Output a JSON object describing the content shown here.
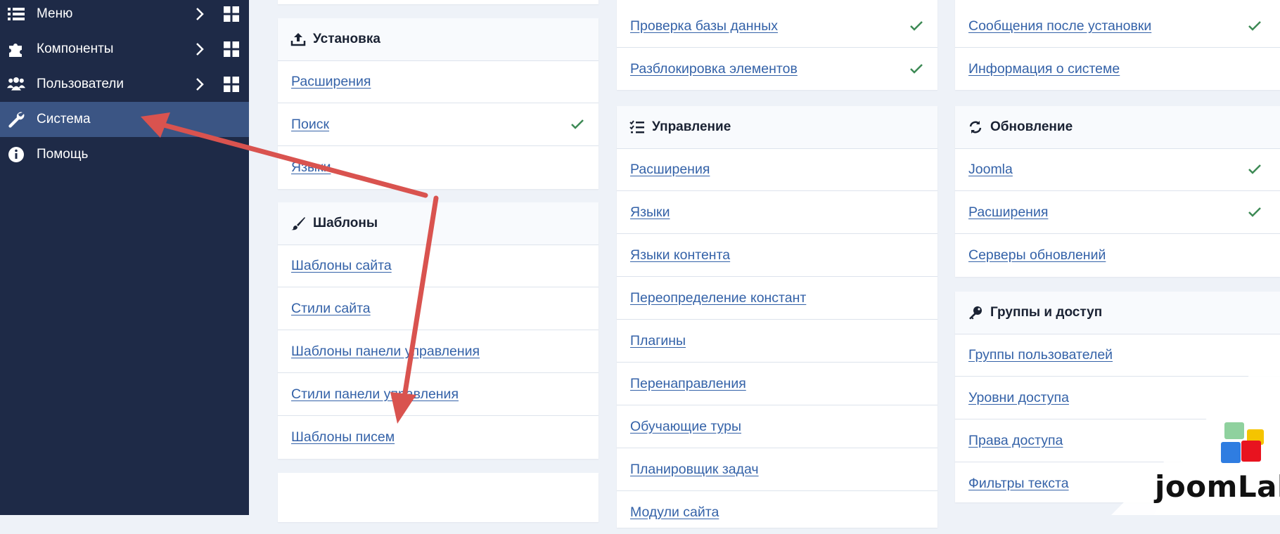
{
  "sidebar": {
    "items": [
      {
        "label": "Меню",
        "icon": "list-icon"
      },
      {
        "label": "Компоненты",
        "icon": "puzzle-icon"
      },
      {
        "label": "Пользователи",
        "icon": "users-icon"
      },
      {
        "label": "Система",
        "icon": "wrench-icon"
      },
      {
        "label": "Помощь",
        "icon": "info-icon"
      }
    ]
  },
  "install_card": {
    "title": "Установка",
    "icon": "upload-icon",
    "items": [
      {
        "label": "Расширения"
      },
      {
        "label": "Поиск",
        "checked": true
      },
      {
        "label": "Языки"
      }
    ]
  },
  "templates_card": {
    "title": "Шаблоны",
    "icon": "paintbrush-icon",
    "items": [
      {
        "label": "Шаблоны сайта"
      },
      {
        "label": "Стили сайта"
      },
      {
        "label": "Шаблоны панели управления"
      },
      {
        "label": "Стили панели управления"
      },
      {
        "label": "Шаблоны писем"
      }
    ]
  },
  "maintenance_card": {
    "items": [
      {
        "label": "Проверка базы данных",
        "checked": true
      },
      {
        "label": "Разблокировка элементов",
        "checked": true
      }
    ]
  },
  "manage_card": {
    "title": "Управление",
    "icon": "tasks-icon",
    "items": [
      {
        "label": "Расширения"
      },
      {
        "label": "Языки"
      },
      {
        "label": "Языки контента"
      },
      {
        "label": "Переопределение констант"
      },
      {
        "label": "Плагины"
      },
      {
        "label": "Перенаправления"
      },
      {
        "label": "Обучающие туры"
      },
      {
        "label": "Планировщик задач"
      },
      {
        "label": "Модули сайта"
      }
    ]
  },
  "info_card": {
    "items": [
      {
        "label": "Сообщения после установки",
        "checked": true
      },
      {
        "label": "Информация о системе"
      }
    ]
  },
  "update_card": {
    "title": "Обновление",
    "icon": "sync-icon",
    "items": [
      {
        "label": "Joomla",
        "checked": true
      },
      {
        "label": "Расширения",
        "checked": true
      },
      {
        "label": "Серверы обновлений"
      }
    ]
  },
  "access_card": {
    "title": "Группы и доступ",
    "icon": "key-icon",
    "items": [
      {
        "label": "Группы пользователей"
      },
      {
        "label": "Уровни доступа"
      },
      {
        "label": "Права доступа"
      },
      {
        "label": "Фильтры текста"
      }
    ]
  },
  "logo": {
    "text": "joomLab"
  },
  "colors": {
    "sidebar_bg": "#1e2a47",
    "sidebar_active": "#3b5584",
    "link": "#3462a8",
    "check": "#3d8a55",
    "annotation_arrow": "#d9534f"
  }
}
